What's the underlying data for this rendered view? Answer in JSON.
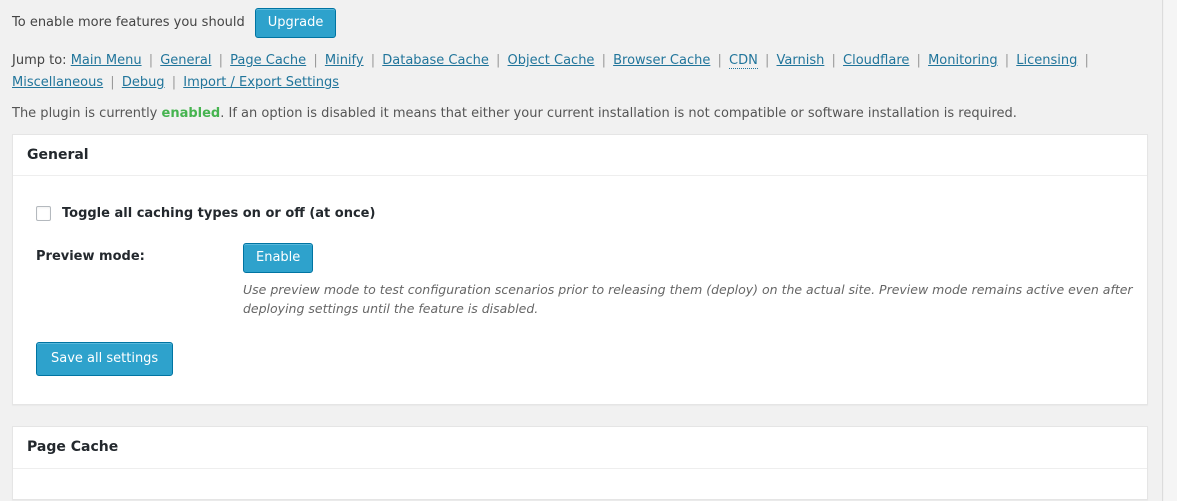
{
  "notice": {
    "text": "To enable more features you should",
    "upgrade_label": "Upgrade"
  },
  "jump_to": {
    "label": "Jump to:",
    "separator": "|",
    "links": [
      {
        "label": "Main Menu",
        "style": "underline"
      },
      {
        "label": "General",
        "style": "underline"
      },
      {
        "label": "Page Cache",
        "style": "underline"
      },
      {
        "label": "Minify",
        "style": "underline"
      },
      {
        "label": "Database Cache",
        "style": "underline"
      },
      {
        "label": "Object Cache",
        "style": "underline"
      },
      {
        "label": "Browser Cache",
        "style": "underline"
      },
      {
        "label": "CDN",
        "style": "abbr-dotted"
      },
      {
        "label": "Varnish",
        "style": "underline"
      },
      {
        "label": "Cloudflare",
        "style": "underline"
      },
      {
        "label": "Monitoring",
        "style": "underline"
      },
      {
        "label": "Licensing",
        "style": "underline"
      },
      {
        "label": "Miscellaneous",
        "style": "underline"
      },
      {
        "label": "Debug",
        "style": "underline"
      },
      {
        "label": "Import / Export Settings",
        "style": "underline"
      }
    ]
  },
  "status": {
    "prefix": "The plugin is currently ",
    "state": "enabled",
    "suffix": ". If an option is disabled it means that either your current installation is not compatible or software installation is required.",
    "state_color": "#46b450"
  },
  "general_panel": {
    "title": "General",
    "toggle_all": {
      "label": "Toggle all caching types on or off (at once)",
      "checked": false
    },
    "preview_mode": {
      "label": "Preview mode:",
      "button_label": "Enable",
      "help": "Use preview mode to test configuration scenarios prior to releasing them (deploy) on the actual site. Preview mode remains active even after deploying settings until the feature is disabled."
    },
    "save_label": "Save all settings"
  },
  "page_cache_panel": {
    "title": "Page Cache"
  },
  "colors": {
    "accent": "#2ea2cc",
    "accent_border": "#0074a2",
    "link": "#21759b",
    "page_background": "#f1f1f1",
    "panel_background": "#ffffff",
    "panel_border": "#e5e5e5",
    "heading": "#23282d"
  }
}
